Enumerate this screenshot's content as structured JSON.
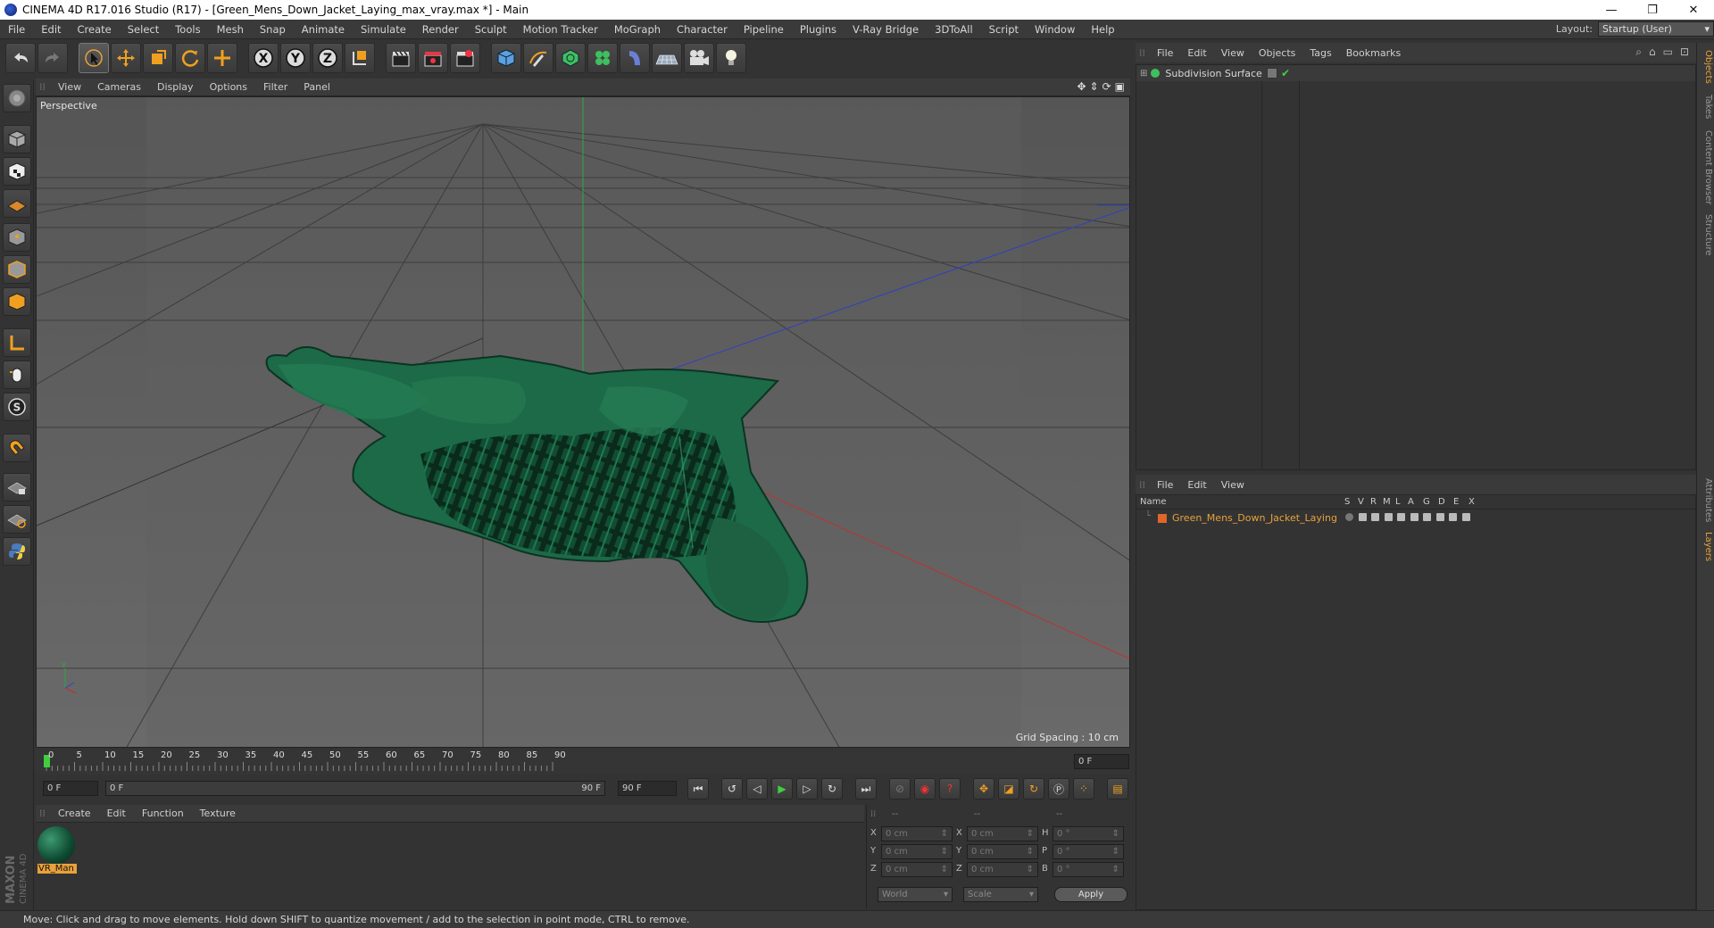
{
  "window": {
    "title": "CINEMA 4D R17.016 Studio (R17) - [Green_Mens_Down_Jacket_Laying_max_vray.max *] - Main",
    "controls": [
      "—",
      "❐",
      "✕"
    ]
  },
  "menubar": {
    "items": [
      "File",
      "Edit",
      "Create",
      "Select",
      "Tools",
      "Mesh",
      "Snap",
      "Animate",
      "Simulate",
      "Render",
      "Sculpt",
      "Motion Tracker",
      "MoGraph",
      "Character",
      "Pipeline",
      "Plugins",
      "V-Ray Bridge",
      "3DToAll",
      "Script",
      "Window",
      "Help"
    ],
    "layout_label": "Layout:",
    "layout_value": "Startup (User)"
  },
  "viewport": {
    "menu": [
      "View",
      "Cameras",
      "Display",
      "Options",
      "Filter",
      "Panel"
    ],
    "label": "Perspective",
    "grid_spacing": "Grid Spacing : 10 cm"
  },
  "timeline": {
    "ticks": [
      "0",
      "5",
      "10",
      "15",
      "20",
      "25",
      "30",
      "35",
      "40",
      "45",
      "50",
      "55",
      "60",
      "65",
      "70",
      "75",
      "80",
      "85",
      "90"
    ],
    "current_frame": "0 F",
    "start_field": "0 F",
    "slider_start": "0 F",
    "slider_end": "90 F",
    "end_field": "90 F"
  },
  "material_manager": {
    "menu": [
      "Create",
      "Edit",
      "Function",
      "Texture"
    ],
    "materials": [
      {
        "name": "VR_Man"
      }
    ]
  },
  "coordinates": {
    "headers": [
      "--",
      "--",
      "--"
    ],
    "rows": [
      {
        "a": "X",
        "av": "0 cm",
        "b": "X",
        "bv": "0 cm",
        "c": "H",
        "cv": "0 °"
      },
      {
        "a": "Y",
        "av": "0 cm",
        "b": "Y",
        "bv": "0 cm",
        "c": "P",
        "cv": "0 °"
      },
      {
        "a": "Z",
        "av": "0 cm",
        "b": "Z",
        "bv": "0 cm",
        "c": "B",
        "cv": "0 °"
      }
    ],
    "mode1": "World",
    "mode2": "Scale",
    "apply": "Apply"
  },
  "object_manager": {
    "menu": [
      "File",
      "Edit",
      "View",
      "Objects",
      "Tags",
      "Bookmarks"
    ],
    "objects": [
      {
        "name": "Subdivision Surface"
      }
    ]
  },
  "layer_manager": {
    "menu": [
      "File",
      "Edit",
      "View"
    ],
    "columns": [
      "Name",
      "S",
      "V",
      "R",
      "M",
      "L",
      "A",
      "G",
      "D",
      "E",
      "X"
    ],
    "layers": [
      {
        "name": "Green_Mens_Down_Jacket_Laying",
        "color": "#e0662a"
      }
    ]
  },
  "side_tabs": [
    "Objects",
    "Takes",
    "Content Browser",
    "Structure",
    "Attributes",
    "Layers"
  ],
  "status": "Move: Click and drag to move elements. Hold down SHIFT to quantize movement / add to the selection in point mode, CTRL to remove.",
  "brand": {
    "maxon": "MAXON",
    "product": "CINEMA 4D"
  },
  "colors": {
    "accent_orange": "#e8a23a",
    "active_play": "#3fcf3f",
    "jacket": "#1f6b4a"
  }
}
